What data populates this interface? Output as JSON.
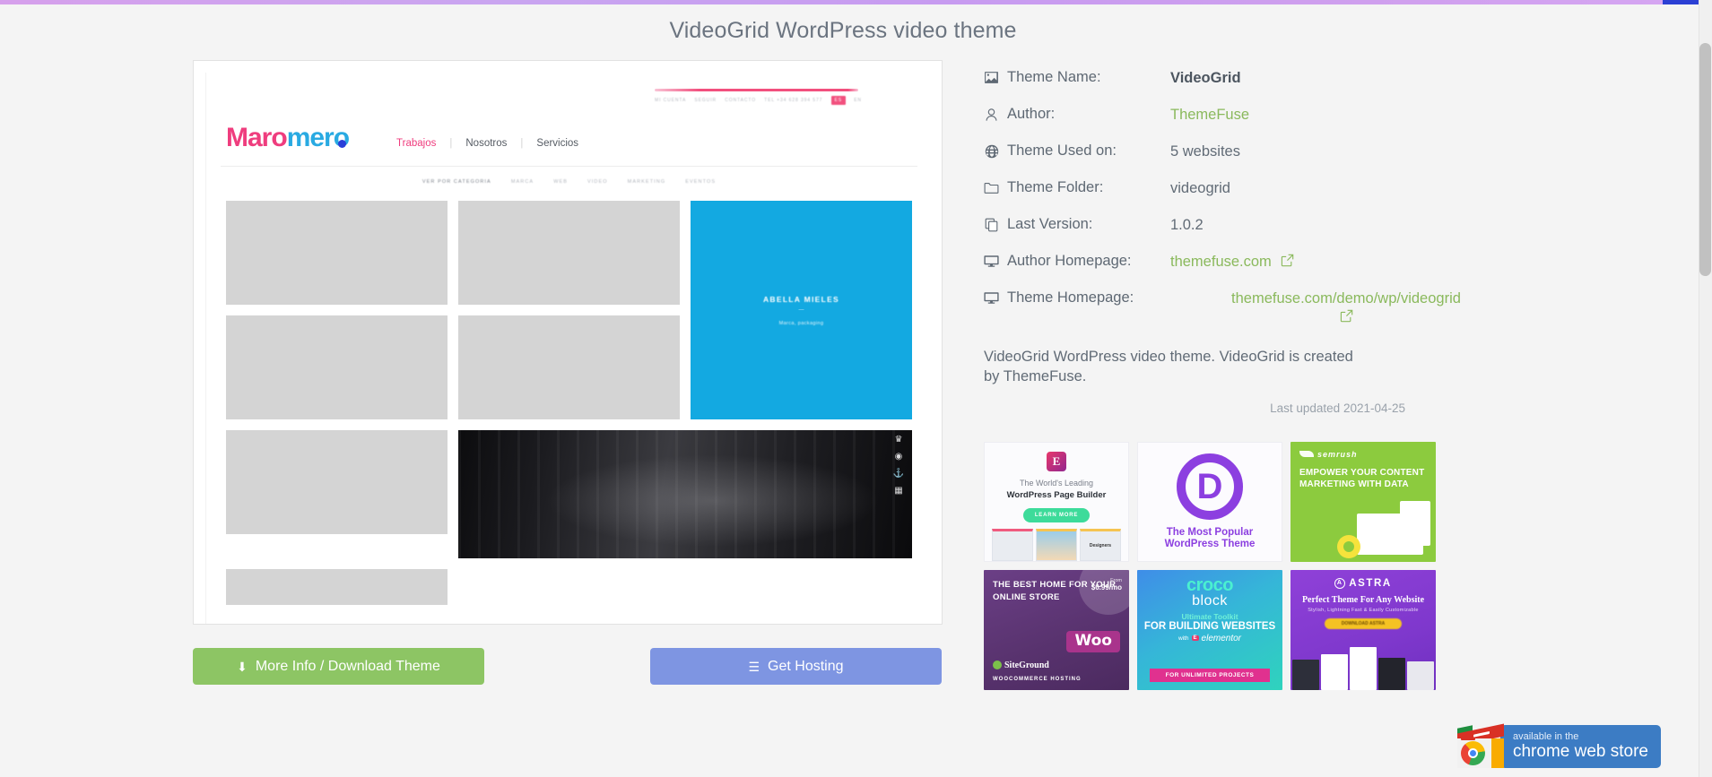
{
  "page": {
    "title": "VideoGrid WordPress video theme"
  },
  "preview": {
    "site_logo_part1": "Maro",
    "site_logo_part2": "mero",
    "nav": [
      "Trabajos",
      "Nosotros",
      "Servicios"
    ],
    "filters_lead": "VER POR CATEGORIA",
    "filters": [
      "MARCA",
      "WEB",
      "VIDEO",
      "MARKETING",
      "EVENTOS"
    ],
    "topbar_items": [
      "MI CUENTA",
      "SEGUIR",
      "CONTACTO",
      "TEL +34 628 394 577"
    ],
    "topbar_lang": "ES",
    "topbar_lang_alt": "EN",
    "featured_tile_title": "ABELLA MIELES",
    "featured_tile_sub": "Marca, packaging",
    "featured_tile_dash": "—"
  },
  "buttons": {
    "download_label": "More Info / Download Theme",
    "download_icon": "download-icon",
    "hosting_label": "Get Hosting",
    "hosting_icon": "server-icon"
  },
  "meta": {
    "rows": [
      {
        "icon": "image-icon",
        "label": "Theme Name:",
        "value": "VideoGrid",
        "style": "bold"
      },
      {
        "icon": "user-icon",
        "label": "Author:",
        "value": "ThemeFuse",
        "style": "link"
      },
      {
        "icon": "globe-icon",
        "label": "Theme Used on:",
        "value": "5 websites",
        "style": "plain"
      },
      {
        "icon": "folder-icon",
        "label": "Theme Folder:",
        "value": "videogrid",
        "style": "plain"
      },
      {
        "icon": "copy-icon",
        "label": "Last Version:",
        "value": "1.0.2",
        "style": "plain"
      },
      {
        "icon": "monitor-icon",
        "label": "Author Homepage:",
        "value": "themefuse.com",
        "style": "link-ext"
      },
      {
        "icon": "monitor-icon",
        "label": "Theme Homepage:",
        "value": "themefuse.com/demo/wp/videogrid",
        "style": "link-ext-center"
      }
    ]
  },
  "description": {
    "text": "VideoGrid WordPress video theme. VideoGrid is created by ThemeFuse.",
    "updated": "Last updated 2021-04-25"
  },
  "ads": [
    {
      "id": "elementor",
      "line1": "The World's Leading",
      "line2": "WordPress Page Builder",
      "cta": "LEARN MORE",
      "badge": "E",
      "thumb_label": "Designers"
    },
    {
      "id": "divi",
      "letter": "D",
      "line1": "The Most Popular",
      "line2": "WordPress Theme"
    },
    {
      "id": "semrush",
      "brand": "semrush",
      "headline": "EMPOWER YOUR CONTENT MARKETING WITH DATA"
    },
    {
      "id": "siteground",
      "headline": "THE BEST HOME FOR YOUR ONLINE STORE",
      "price_from": "From",
      "price_value": "$6.99/mo",
      "woo": "Woo",
      "brand": "SiteGround",
      "caption": "WOOCOMMERCE HOSTING"
    },
    {
      "id": "crocoblock",
      "line1": "croco",
      "line2": "block",
      "line3": "Ultimate Toolkit",
      "line4": "FOR BUILDING WEBSITES",
      "with": "with",
      "partner": "elementor",
      "tag": "FOR UNLIMITED PROJECTS"
    },
    {
      "id": "astra",
      "brand": "ASTRA",
      "headline": "Perfect Theme For Any Website",
      "sub": "Stylish, Lightning Fast & Easily Customizable",
      "cta": "DOWNLOAD ASTRA"
    }
  ],
  "chrome_badge": {
    "line1": "available in the",
    "line2": "chrome web store"
  },
  "colors": {
    "accent_green": "#8dc564",
    "accent_blue": "#7e95e2",
    "link_green": "#8ab95c",
    "page_bg": "#f4f4f4"
  }
}
